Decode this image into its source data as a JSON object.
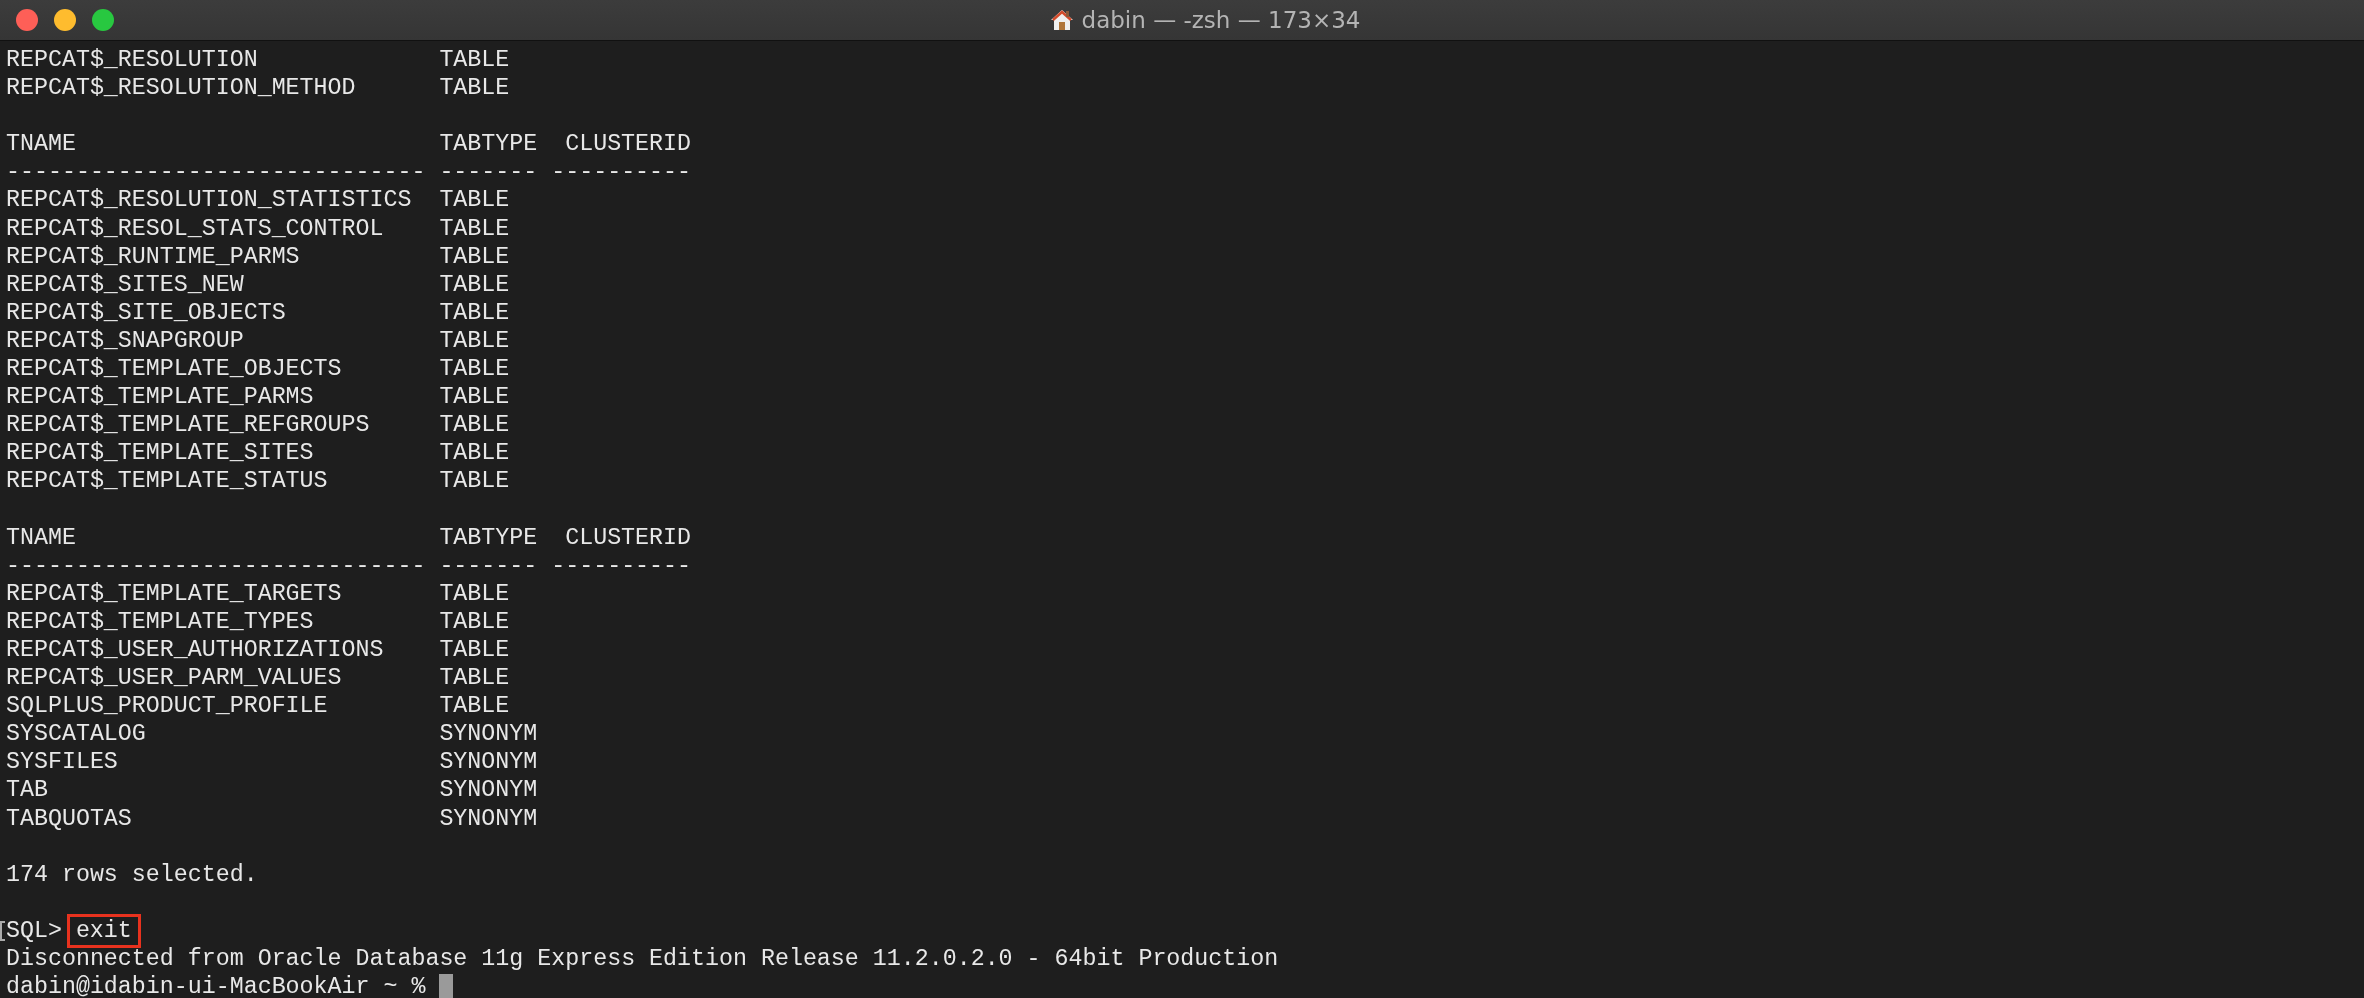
{
  "window": {
    "title": "dabin — -zsh — 173×34"
  },
  "lines": [
    {
      "kind": "row",
      "tname": "REPCAT$_RESOLUTION",
      "tabtype": "TABLE"
    },
    {
      "kind": "row",
      "tname": "REPCAT$_RESOLUTION_METHOD",
      "tabtype": "TABLE"
    },
    {
      "kind": "blank"
    },
    {
      "kind": "header",
      "columns": [
        "TNAME",
        "TABTYPE",
        "CLUSTERID"
      ]
    },
    {
      "kind": "rule",
      "text": "------------------------------ ------- ----------"
    },
    {
      "kind": "row",
      "tname": "REPCAT$_RESOLUTION_STATISTICS",
      "tabtype": "TABLE"
    },
    {
      "kind": "row",
      "tname": "REPCAT$_RESOL_STATS_CONTROL",
      "tabtype": "TABLE"
    },
    {
      "kind": "row",
      "tname": "REPCAT$_RUNTIME_PARMS",
      "tabtype": "TABLE"
    },
    {
      "kind": "row",
      "tname": "REPCAT$_SITES_NEW",
      "tabtype": "TABLE"
    },
    {
      "kind": "row",
      "tname": "REPCAT$_SITE_OBJECTS",
      "tabtype": "TABLE"
    },
    {
      "kind": "row",
      "tname": "REPCAT$_SNAPGROUP",
      "tabtype": "TABLE"
    },
    {
      "kind": "row",
      "tname": "REPCAT$_TEMPLATE_OBJECTS",
      "tabtype": "TABLE"
    },
    {
      "kind": "row",
      "tname": "REPCAT$_TEMPLATE_PARMS",
      "tabtype": "TABLE"
    },
    {
      "kind": "row",
      "tname": "REPCAT$_TEMPLATE_REFGROUPS",
      "tabtype": "TABLE"
    },
    {
      "kind": "row",
      "tname": "REPCAT$_TEMPLATE_SITES",
      "tabtype": "TABLE"
    },
    {
      "kind": "row",
      "tname": "REPCAT$_TEMPLATE_STATUS",
      "tabtype": "TABLE"
    },
    {
      "kind": "blank"
    },
    {
      "kind": "header",
      "columns": [
        "TNAME",
        "TABTYPE",
        "CLUSTERID"
      ]
    },
    {
      "kind": "rule",
      "text": "------------------------------ ------- ----------"
    },
    {
      "kind": "row",
      "tname": "REPCAT$_TEMPLATE_TARGETS",
      "tabtype": "TABLE"
    },
    {
      "kind": "row",
      "tname": "REPCAT$_TEMPLATE_TYPES",
      "tabtype": "TABLE"
    },
    {
      "kind": "row",
      "tname": "REPCAT$_USER_AUTHORIZATIONS",
      "tabtype": "TABLE"
    },
    {
      "kind": "row",
      "tname": "REPCAT$_USER_PARM_VALUES",
      "tabtype": "TABLE"
    },
    {
      "kind": "row",
      "tname": "SQLPLUS_PRODUCT_PROFILE",
      "tabtype": "TABLE"
    },
    {
      "kind": "row",
      "tname": "SYSCATALOG",
      "tabtype": "SYNONYM"
    },
    {
      "kind": "row",
      "tname": "SYSFILES",
      "tabtype": "SYNONYM"
    },
    {
      "kind": "row",
      "tname": "TAB",
      "tabtype": "SYNONYM"
    },
    {
      "kind": "row",
      "tname": "TABQUOTAS",
      "tabtype": "SYNONYM"
    },
    {
      "kind": "blank"
    },
    {
      "kind": "text",
      "text": "174 rows selected."
    },
    {
      "kind": "blank"
    },
    {
      "kind": "prompt",
      "prompt": "SQL>",
      "command": "exit",
      "highlighted": true
    },
    {
      "kind": "text",
      "text": "Disconnected from Oracle Database 11g Express Edition Release 11.2.0.2.0 - 64bit Production"
    },
    {
      "kind": "shell",
      "text": "dabin@idabin-ui-MacBookAir ~ %",
      "cursor": true
    }
  ]
}
